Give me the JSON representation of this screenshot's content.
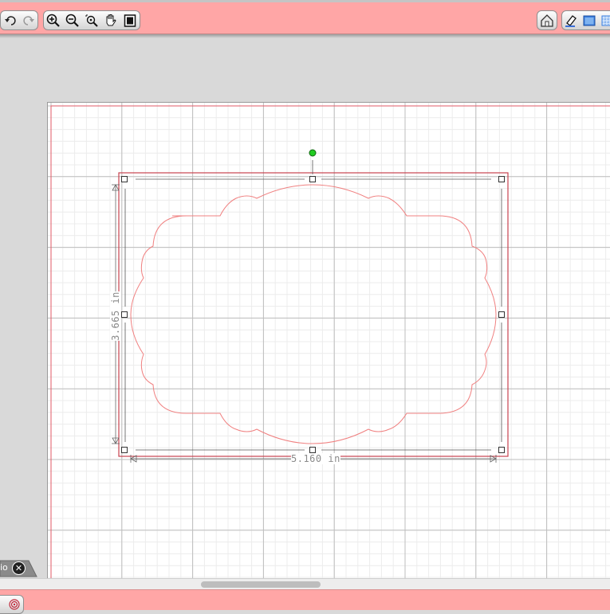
{
  "toolbar": {
    "left_history": [
      {
        "name": "undo-icon"
      },
      {
        "name": "redo-icon"
      }
    ],
    "left_tools": [
      {
        "name": "zoom-in-icon"
      },
      {
        "name": "zoom-out-icon"
      },
      {
        "name": "zoom-fit-icon"
      },
      {
        "name": "pan-hand-icon"
      },
      {
        "name": "fit-page-icon"
      }
    ],
    "right_tools": [
      {
        "name": "home-icon"
      },
      {
        "name": "eraser-icon"
      },
      {
        "name": "fill-icon"
      },
      {
        "name": "grid-toggle-icon"
      }
    ]
  },
  "canvas": {
    "shape": {
      "name": "scalloped-frame",
      "stroke_color": "#f08080",
      "handle_color": "#22cc22"
    },
    "dimensions": {
      "width_label": "5.160 in",
      "height_label": "3.665 in"
    }
  },
  "bottom_tab": {
    "label": "io",
    "close_icon": "close-icon"
  },
  "colors": {
    "toolbar_bg": "#ffa6a6",
    "mat_border": "#e05a66",
    "grid_major": "#bdbdbd",
    "grid_minor": "#ececec"
  }
}
